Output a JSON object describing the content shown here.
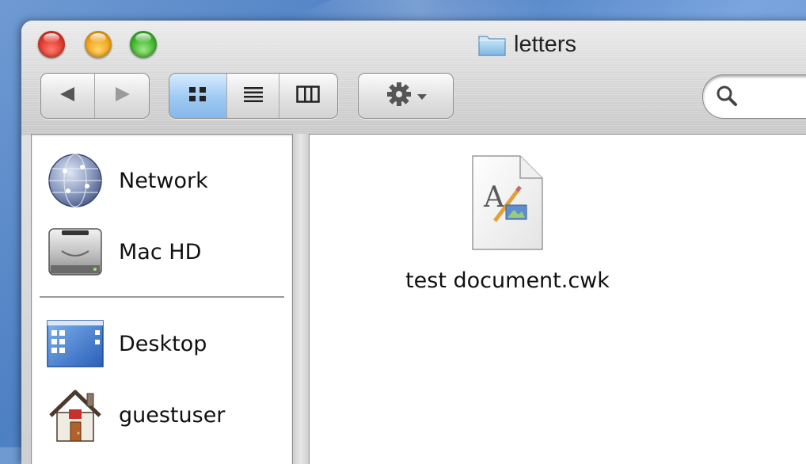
{
  "window": {
    "title": "letters",
    "title_icon": "folder-icon"
  },
  "toolbar": {
    "back_icon": "back-arrow-icon",
    "forward_icon": "forward-arrow-icon",
    "view_modes": [
      {
        "name": "icon-view",
        "icon": "icon-view-icon",
        "active": true
      },
      {
        "name": "list-view",
        "icon": "list-view-icon",
        "active": false
      },
      {
        "name": "column-view",
        "icon": "column-view-icon",
        "active": false
      }
    ],
    "action_icon": "gear-icon",
    "search": {
      "value": "",
      "placeholder": "",
      "icon": "magnifier-icon"
    }
  },
  "sidebar": {
    "items": [
      {
        "label": "Network",
        "icon": "network-globe-icon"
      },
      {
        "label": "Mac HD",
        "icon": "hard-drive-icon"
      },
      {
        "label": "Desktop",
        "icon": "desktop-icon"
      },
      {
        "label": "guestuser",
        "icon": "home-icon"
      }
    ]
  },
  "content": {
    "files": [
      {
        "name": "test document.cwk",
        "icon": "appleworks-document-icon"
      }
    ]
  },
  "colors": {
    "close": "#e0382c",
    "minimize": "#f0a41a",
    "zoom": "#3fb22b",
    "selected_segment": "#9dc9f3",
    "desktop": "#5b8bd0"
  }
}
